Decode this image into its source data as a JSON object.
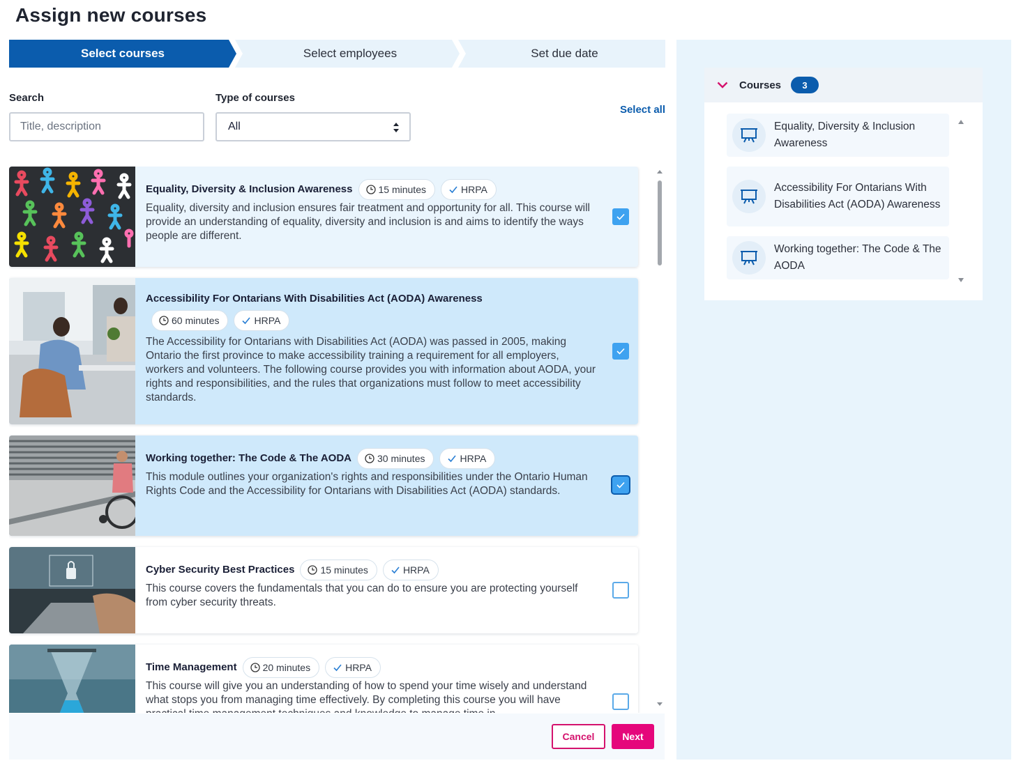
{
  "page": {
    "title": "Assign new courses"
  },
  "stepper": {
    "steps": [
      {
        "label": "Select courses",
        "active": true
      },
      {
        "label": "Select employees",
        "active": false
      },
      {
        "label": "Set due date",
        "active": false
      }
    ]
  },
  "filters": {
    "search_label": "Search",
    "search_placeholder": "Title, description",
    "search_value": "",
    "type_label": "Type of courses",
    "type_value": "All",
    "select_all": "Select all"
  },
  "courses": [
    {
      "title": "Equality, Diversity & Inclusion Awareness",
      "duration": "15 minutes",
      "badge": "HRPA",
      "description": "Equality, diversity and inclusion ensures fair treatment and opportunity for all. This course will provide an understanding of equality, diversity and inclusion is and aims to identify the ways people are different.",
      "checked": true,
      "image": "colorful-people-figures"
    },
    {
      "title": "Accessibility For Ontarians With Disabilities Act (AODA) Awareness",
      "duration": "60 minutes",
      "badge": "HRPA",
      "description": "The Accessibility for Ontarians with Disabilities Act (AODA) was passed in 2005, making Ontario the first province to make accessibility training a requirement for all employers, workers and volunteers. The following course provides you with information about AODA, your rights and responsibilities, and the rules that organizations must follow to meet accessibility standards.",
      "checked": true,
      "image": "office-workers"
    },
    {
      "title": "Working together: The Code & The AODA",
      "duration": "30 minutes",
      "badge": "HRPA",
      "description": "This module outlines your organization's rights and responsibilities under the Ontario Human Rights Code and the Accessibility for Ontarians with Disabilities Act (AODA) standards.",
      "checked": true,
      "image": "wheelchair-ramp"
    },
    {
      "title": "Cyber Security Best Practices",
      "duration": "15 minutes",
      "badge": "HRPA",
      "description": "This course covers the fundamentals that you can do to ensure you are protecting yourself from cyber security threats.",
      "checked": false,
      "image": "laptop-security"
    },
    {
      "title": "Time Management",
      "duration": "20 minutes",
      "badge": "HRPA",
      "description": "This course will give you an understanding of how to spend your time wisely and understand what stops you from managing time effectively. By completing this course you will have practical time management techniques and knowledge to manage time in ...",
      "checked": false,
      "image": "hourglass"
    }
  ],
  "footer": {
    "cancel": "Cancel",
    "next": "Next"
  },
  "selected_panel": {
    "label": "Courses",
    "count": "3",
    "items": [
      "Equality, Diversity & Inclusion Awareness",
      "Accessibility For Ontarians With Disabilities Act (AODA) Awareness",
      "Working together: The Code & The AODA"
    ]
  },
  "colors": {
    "primary": "#0b5cad",
    "accent": "#e5077b",
    "checkbox": "#3ea2f0",
    "selected_row": "#cfe9fb"
  }
}
